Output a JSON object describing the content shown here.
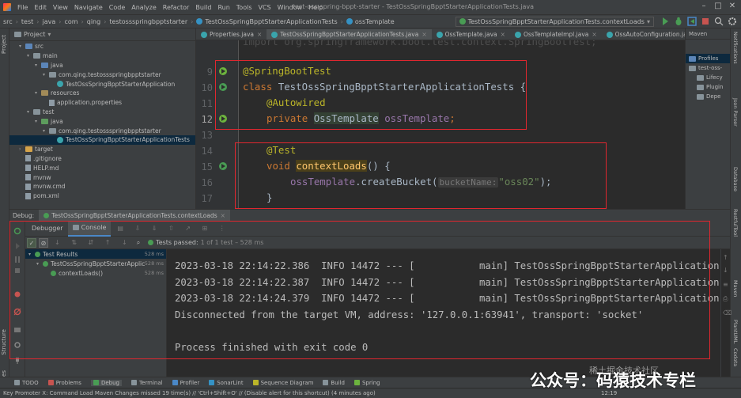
{
  "menu": [
    "File",
    "Edit",
    "View",
    "Navigate",
    "Code",
    "Analyze",
    "Refactor",
    "Build",
    "Run",
    "Tools",
    "VCS",
    "Window",
    "Help"
  ],
  "window_title": "test-oss-spring-bppt-starter - TestOssSpringBpptStarterApplicationTests.java",
  "breadcrumbs": [
    "src",
    "test",
    "java",
    "com",
    "qing",
    "testossspringbpptstarter",
    "TestOssSpringBpptStarterApplicationTests",
    "ossTemplate"
  ],
  "run_config": "TestOssSpringBpptStarterApplicationTests.contextLoads",
  "project_title": "Project",
  "tree": [
    {
      "label": "src",
      "indent": 1,
      "icon": "src",
      "open": true
    },
    {
      "label": "main",
      "indent": 2,
      "icon": "folder",
      "open": true
    },
    {
      "label": "java",
      "indent": 3,
      "icon": "src",
      "open": true
    },
    {
      "label": "com.qing.testossspringbpptstarter",
      "indent": 4,
      "icon": "folder",
      "open": true
    },
    {
      "label": "TestOssSpringBpptStarterApplication",
      "indent": 5,
      "icon": "java",
      "open": null
    },
    {
      "label": "resources",
      "indent": 3,
      "icon": "res",
      "open": true
    },
    {
      "label": "application.properties",
      "indent": 4,
      "icon": "file",
      "open": null
    },
    {
      "label": "test",
      "indent": 2,
      "icon": "folder",
      "open": true
    },
    {
      "label": "java",
      "indent": 3,
      "icon": "test",
      "open": true
    },
    {
      "label": "com.qing.testossspringbpptstarter",
      "indent": 4,
      "icon": "folder",
      "open": true
    },
    {
      "label": "TestOssSpringBpptStarterApplicationTests",
      "indent": 5,
      "icon": "java",
      "open": null,
      "selected": true
    },
    {
      "label": "target",
      "indent": 1,
      "icon": "target",
      "open": false
    },
    {
      "label": ".gitignore",
      "indent": 1,
      "icon": "file",
      "open": null
    },
    {
      "label": "HELP.md",
      "indent": 1,
      "icon": "file",
      "open": null
    },
    {
      "label": "mvnw",
      "indent": 1,
      "icon": "file",
      "open": null
    },
    {
      "label": "mvnw.cmd",
      "indent": 1,
      "icon": "file",
      "open": null
    },
    {
      "label": "pom.xml",
      "indent": 1,
      "icon": "file",
      "open": null
    }
  ],
  "tabs": [
    {
      "label": "Properties.java",
      "active": false
    },
    {
      "label": "TestOssSpringBpptStarterApplicationTests.java",
      "active": true
    },
    {
      "label": "OssTemplate.java",
      "active": false
    },
    {
      "label": "OssTemplateImpl.java",
      "active": false
    },
    {
      "label": "OssAutoConfiguration.java",
      "active": false
    }
  ],
  "editor": {
    "line_numbers": [
      "9",
      "10",
      "11",
      "12",
      "13",
      "14",
      "15",
      "16",
      "17"
    ],
    "code": {
      "l8_top": "import org.springframework.boot.test.context.SpringBootTest;",
      "l9": "@SpringBootTest",
      "l10_kw": "class ",
      "l10_name": "TestOssSpringBpptStarterApplicationTests {",
      "l11": "@Autowired",
      "l12_kw": "private ",
      "l12_type": "OssTemplate",
      "l12_field": " ossTemplate",
      "l12_end": ";",
      "l14": "@Test",
      "l15_kw": "void ",
      "l15_name": "contextLoads",
      "l15_end": "() {",
      "l16_obj": "ossTemplate",
      "l16_call": ".createBucket(",
      "l16_hint": "bucketName:",
      "l16_str": "\"oss02\"",
      "l16_end": ");",
      "l17": "}"
    }
  },
  "maven": {
    "title": "Maven",
    "items": [
      "Profiles",
      "test-oss-",
      "Lifecy",
      "Plugin",
      "Depe"
    ]
  },
  "right_labels": [
    "Notifications",
    "Json Parser",
    "Database",
    "RestfulTool",
    "Maven",
    "PlantUML",
    "Codota"
  ],
  "debug": {
    "label": "Debug:",
    "config": "TestOssSpringBpptStarterApplicationTests.contextLoads",
    "tab_debugger": "Debugger",
    "tab_console": "Console",
    "passed_text": "Tests passed:",
    "passed_detail": "1 of 1 test – 528 ms",
    "tests": [
      {
        "label": "Test Results",
        "dur": "528 ms",
        "indent": 0
      },
      {
        "label": "TestOssSpringBpptStarterApplic",
        "dur": "528 ms",
        "indent": 1
      },
      {
        "label": "contextLoads()",
        "dur": "528 ms",
        "indent": 2
      }
    ],
    "console": [
      "2023-03-18 22:14:22.386  INFO 14472 --- [           main] TestOssSpringBpptStarterApplication",
      "2023-03-18 22:14:22.387  INFO 14472 --- [           main] TestOssSpringBpptStarterApplication",
      "2023-03-18 22:14:24.379  INFO 14472 --- [           main] TestOssSpringBpptStarterApplication",
      "Disconnected from the target VM, address: '127.0.0.1:63941', transport: 'socket'",
      "",
      "Process finished with exit code 0"
    ]
  },
  "left_labels": {
    "project": "Project",
    "structure": "Structure",
    "favorites": "Favorites"
  },
  "bottom_tabs": [
    "TODO",
    "Problems",
    "Debug",
    "Terminal",
    "Profiler",
    "SonarLint",
    "Sequence Diagram",
    "Build",
    "Spring"
  ],
  "status_text": "Key Promoter X: Command Load Maven Changes missed 19 time(s) // 'Ctrl+Shift+O' // (Disable alert for this shortcut) (4 minutes ago)",
  "status_time": "12:19",
  "watermark": "公众号：码猿技术专栏",
  "watermark_small": "稀土掘金技术社区"
}
